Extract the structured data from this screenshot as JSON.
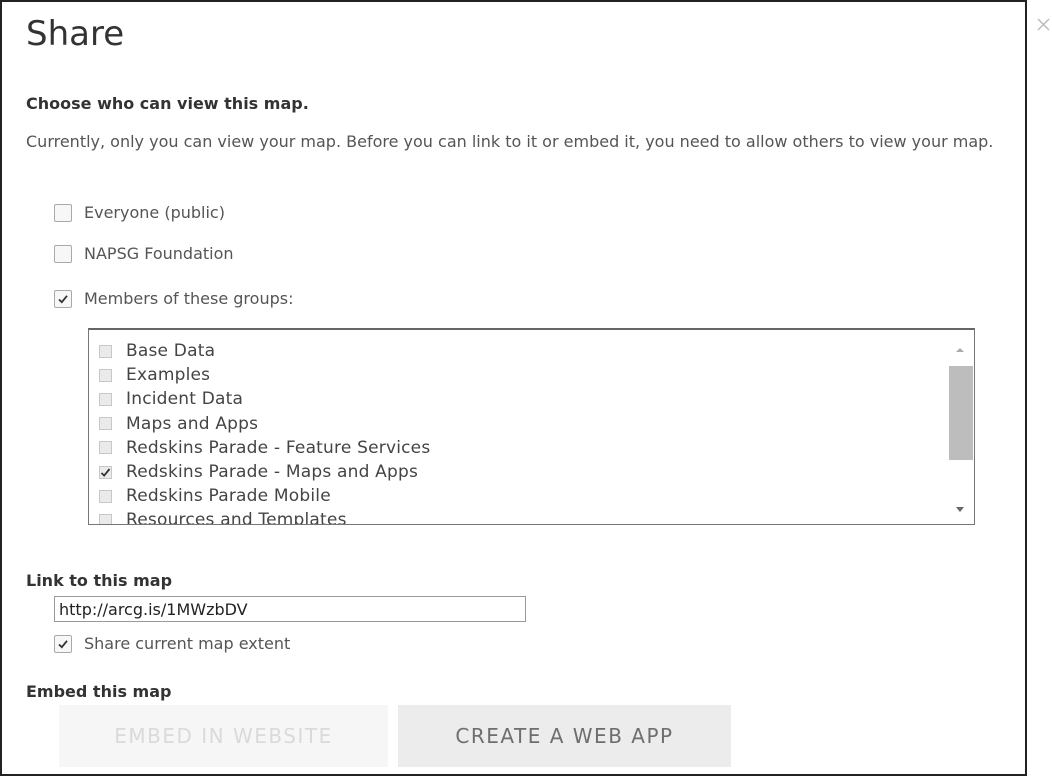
{
  "dialog": {
    "title": "Share",
    "choose_heading": "Choose who can view this map.",
    "description": "Currently, only you can view your map. Before you can link to it or embed it, you need to allow others to view your map.",
    "options": [
      {
        "label": "Everyone (public)",
        "checked": false
      },
      {
        "label": "NAPSG Foundation",
        "checked": false
      },
      {
        "label": "Members of these groups:",
        "checked": true
      }
    ],
    "groups": [
      {
        "label": "Base Data",
        "checked": false
      },
      {
        "label": "Examples",
        "checked": false
      },
      {
        "label": "Incident Data",
        "checked": false
      },
      {
        "label": "Maps and Apps",
        "checked": false
      },
      {
        "label": "Redskins Parade - Feature Services",
        "checked": false
      },
      {
        "label": "Redskins Parade - Maps and Apps",
        "checked": true
      },
      {
        "label": "Redskins Parade Mobile",
        "checked": false
      },
      {
        "label": "Resources and Templates",
        "checked": false
      }
    ],
    "link_heading": "Link to this map",
    "link_value": "http://arcg.is/1MWzbDV",
    "share_extent_label": "Share current map extent",
    "share_extent_checked": true,
    "embed_heading": "Embed this map",
    "embed_button": "EMBED IN WEBSITE",
    "create_button": "CREATE A WEB APP"
  }
}
